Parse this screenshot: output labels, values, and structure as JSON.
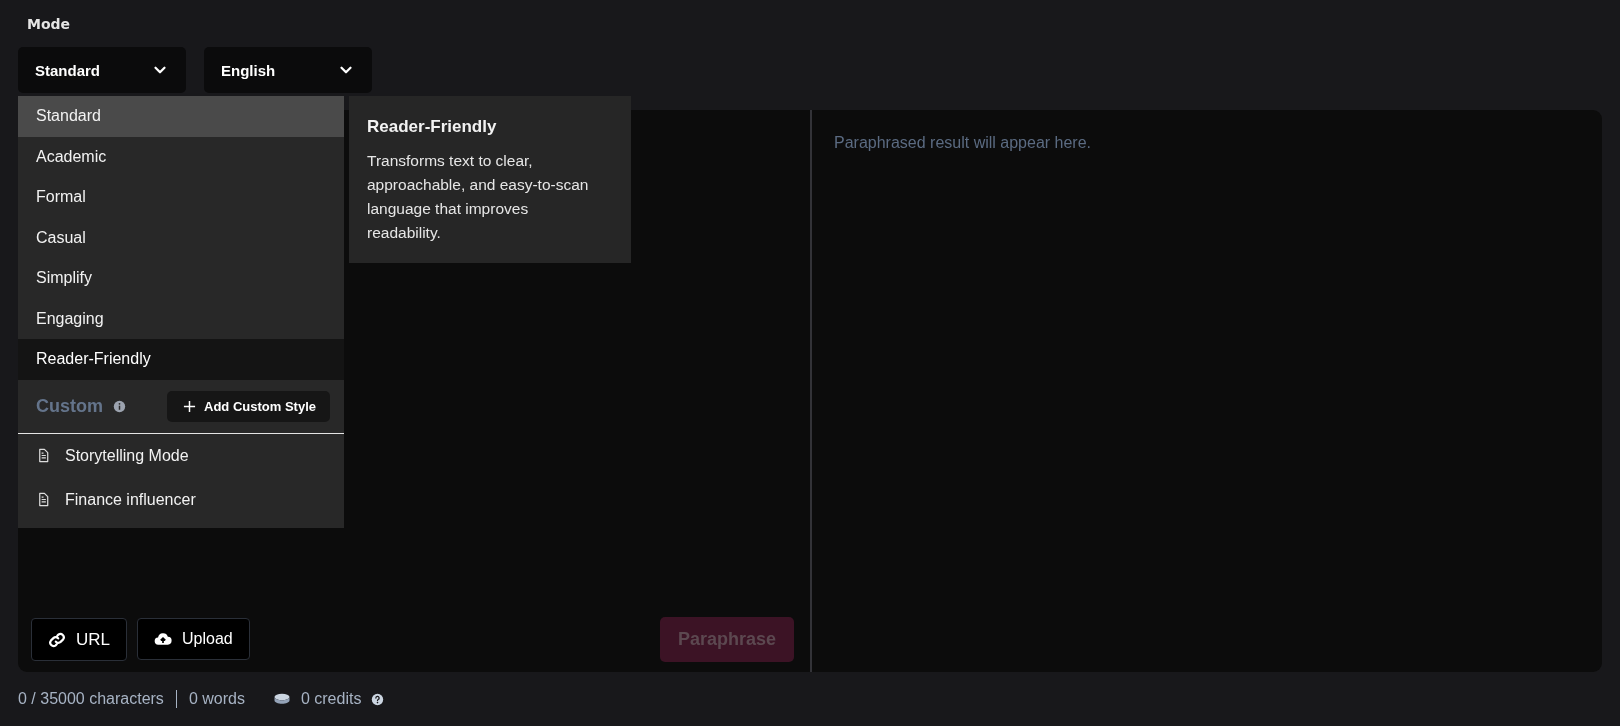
{
  "mode_label": "Mode",
  "selects": [
    {
      "value": "Standard"
    },
    {
      "value": "English"
    }
  ],
  "mode_menu": {
    "items": [
      {
        "label": "Standard",
        "selected": true,
        "hovered": false
      },
      {
        "label": "Academic",
        "selected": false,
        "hovered": false
      },
      {
        "label": "Formal",
        "selected": false,
        "hovered": false
      },
      {
        "label": "Casual",
        "selected": false,
        "hovered": false
      },
      {
        "label": "Simplify",
        "selected": false,
        "hovered": false
      },
      {
        "label": "Engaging",
        "selected": false,
        "hovered": false
      },
      {
        "label": "Reader-Friendly",
        "selected": false,
        "hovered": true
      }
    ],
    "custom_heading": "Custom",
    "add_button": "Add Custom Style",
    "custom_items": [
      "Storytelling Mode",
      "Finance influencer"
    ]
  },
  "tooltip": {
    "title": "Reader-Friendly",
    "text": "Transforms text to clear, approachable, and easy-to-scan language that improves readability."
  },
  "output_placeholder": "Paraphrased result will appear here.",
  "input_buttons": [
    {
      "kind": "link",
      "label": "URL"
    },
    {
      "kind": "upload",
      "label": "Upload"
    }
  ],
  "paraphrase_button": {
    "label": "Paraphrase",
    "disabled": true
  },
  "footer": {
    "characters": "0 / 35000 characters",
    "words": "0 words",
    "credits": "0 credits"
  }
}
